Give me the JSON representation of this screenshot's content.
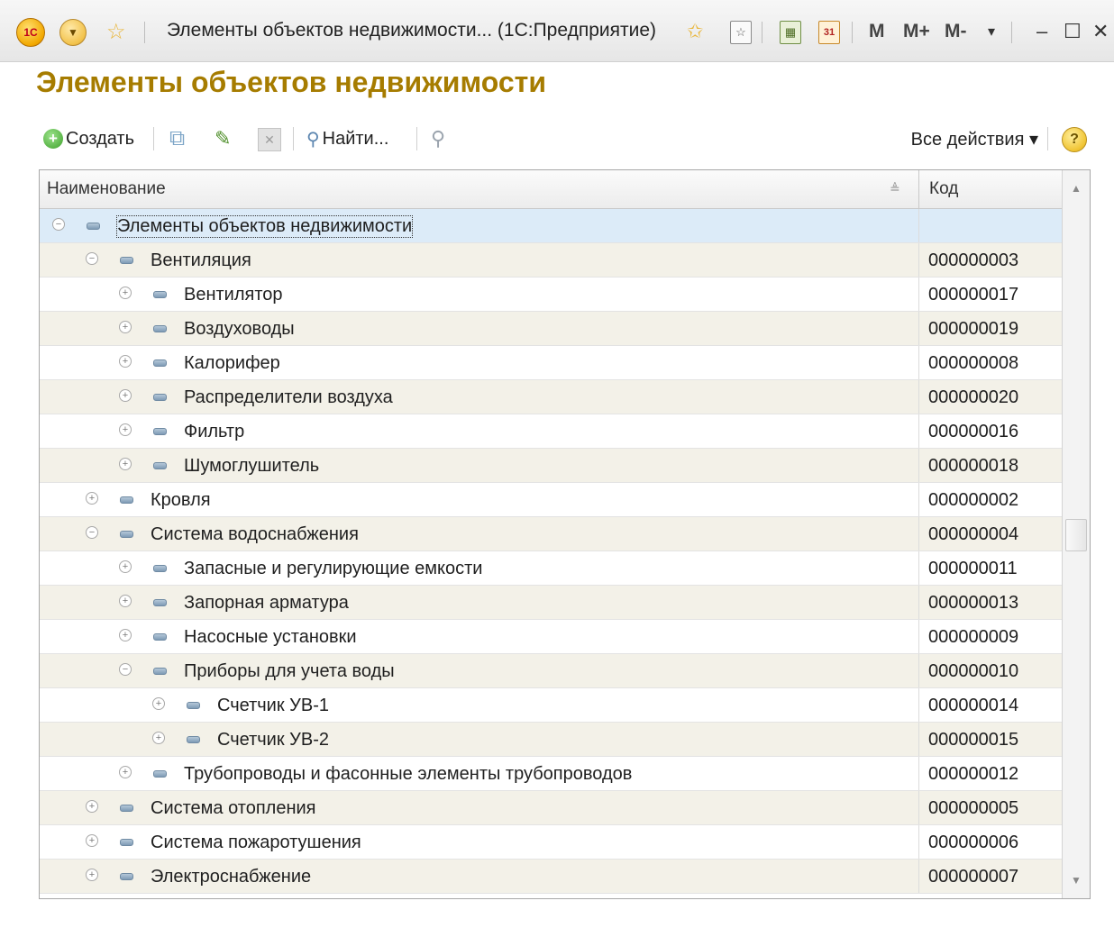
{
  "window": {
    "logo": "1С",
    "title": "Элементы объектов недвижимости... (1С:Предприятие)",
    "calendar_day": "31",
    "memory_buttons": [
      "M",
      "M+",
      "M-"
    ]
  },
  "page": {
    "heading": "Элементы объектов недвижимости"
  },
  "toolbar": {
    "create_label": "Создать",
    "find_label": "Найти...",
    "all_actions_label": "Все действия ▾",
    "help_label": "?"
  },
  "table": {
    "columns": [
      "Наименование",
      "Код"
    ],
    "rows": [
      {
        "name": "Элементы объектов недвижимости",
        "code": "",
        "level": 0,
        "expanded": true
      },
      {
        "name": "Вентиляция",
        "code": "000000003",
        "level": 1,
        "expanded": true
      },
      {
        "name": "Вентилятор",
        "code": "000000017",
        "level": 2,
        "expanded": false
      },
      {
        "name": "Воздуховоды",
        "code": "000000019",
        "level": 2,
        "expanded": false
      },
      {
        "name": "Калорифер",
        "code": "000000008",
        "level": 2,
        "expanded": false
      },
      {
        "name": "Распределители воздуха",
        "code": "000000020",
        "level": 2,
        "expanded": false
      },
      {
        "name": "Фильтр",
        "code": "000000016",
        "level": 2,
        "expanded": false
      },
      {
        "name": "Шумоглушитель",
        "code": "000000018",
        "level": 2,
        "expanded": false
      },
      {
        "name": "Кровля",
        "code": "000000002",
        "level": 1,
        "expanded": false
      },
      {
        "name": "Система водоснабжения",
        "code": "000000004",
        "level": 1,
        "expanded": true
      },
      {
        "name": "Запасные и регулирующие емкости",
        "code": "000000011",
        "level": 2,
        "expanded": false
      },
      {
        "name": "Запорная арматура",
        "code": "000000013",
        "level": 2,
        "expanded": false
      },
      {
        "name": "Насосные установки",
        "code": "000000009",
        "level": 2,
        "expanded": false
      },
      {
        "name": "Приборы для учета воды",
        "code": "000000010",
        "level": 2,
        "expanded": true
      },
      {
        "name": "Счетчик УВ-1",
        "code": "000000014",
        "level": 3,
        "expanded": false
      },
      {
        "name": "Счетчик УВ-2",
        "code": "000000015",
        "level": 3,
        "expanded": false
      },
      {
        "name": "Трубопроводы и фасонные элементы трубопроводов",
        "code": "000000012",
        "level": 2,
        "expanded": false
      },
      {
        "name": "Система отопления",
        "code": "000000005",
        "level": 1,
        "expanded": false
      },
      {
        "name": "Система пожаротушения",
        "code": "000000006",
        "level": 1,
        "expanded": false
      },
      {
        "name": "Электроснабжение",
        "code": "000000007",
        "level": 1,
        "expanded": false
      }
    ]
  }
}
